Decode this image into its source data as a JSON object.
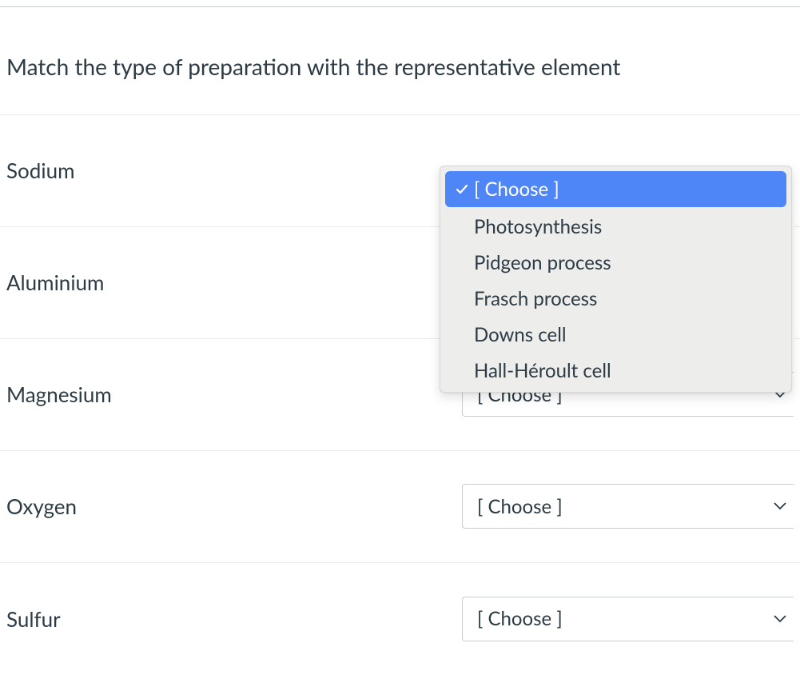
{
  "question": "Match the type of preparation with the representative element",
  "select_placeholder": "[ Choose ]",
  "rows": [
    {
      "label": "Sodium",
      "value": "[ Choose ]"
    },
    {
      "label": "Aluminium",
      "value": "[ Choose ]"
    },
    {
      "label": "Magnesium",
      "value": "[ Choose ]"
    },
    {
      "label": "Oxygen",
      "value": "[ Choose ]"
    },
    {
      "label": "Sulfur",
      "value": "[ Choose ]"
    }
  ],
  "dropdown": {
    "selected_label": "[ Choose ]",
    "options": [
      "Photosynthesis",
      "Pidgeon process",
      "Frasch process",
      "Downs cell",
      "Hall-Héroult cell"
    ]
  }
}
